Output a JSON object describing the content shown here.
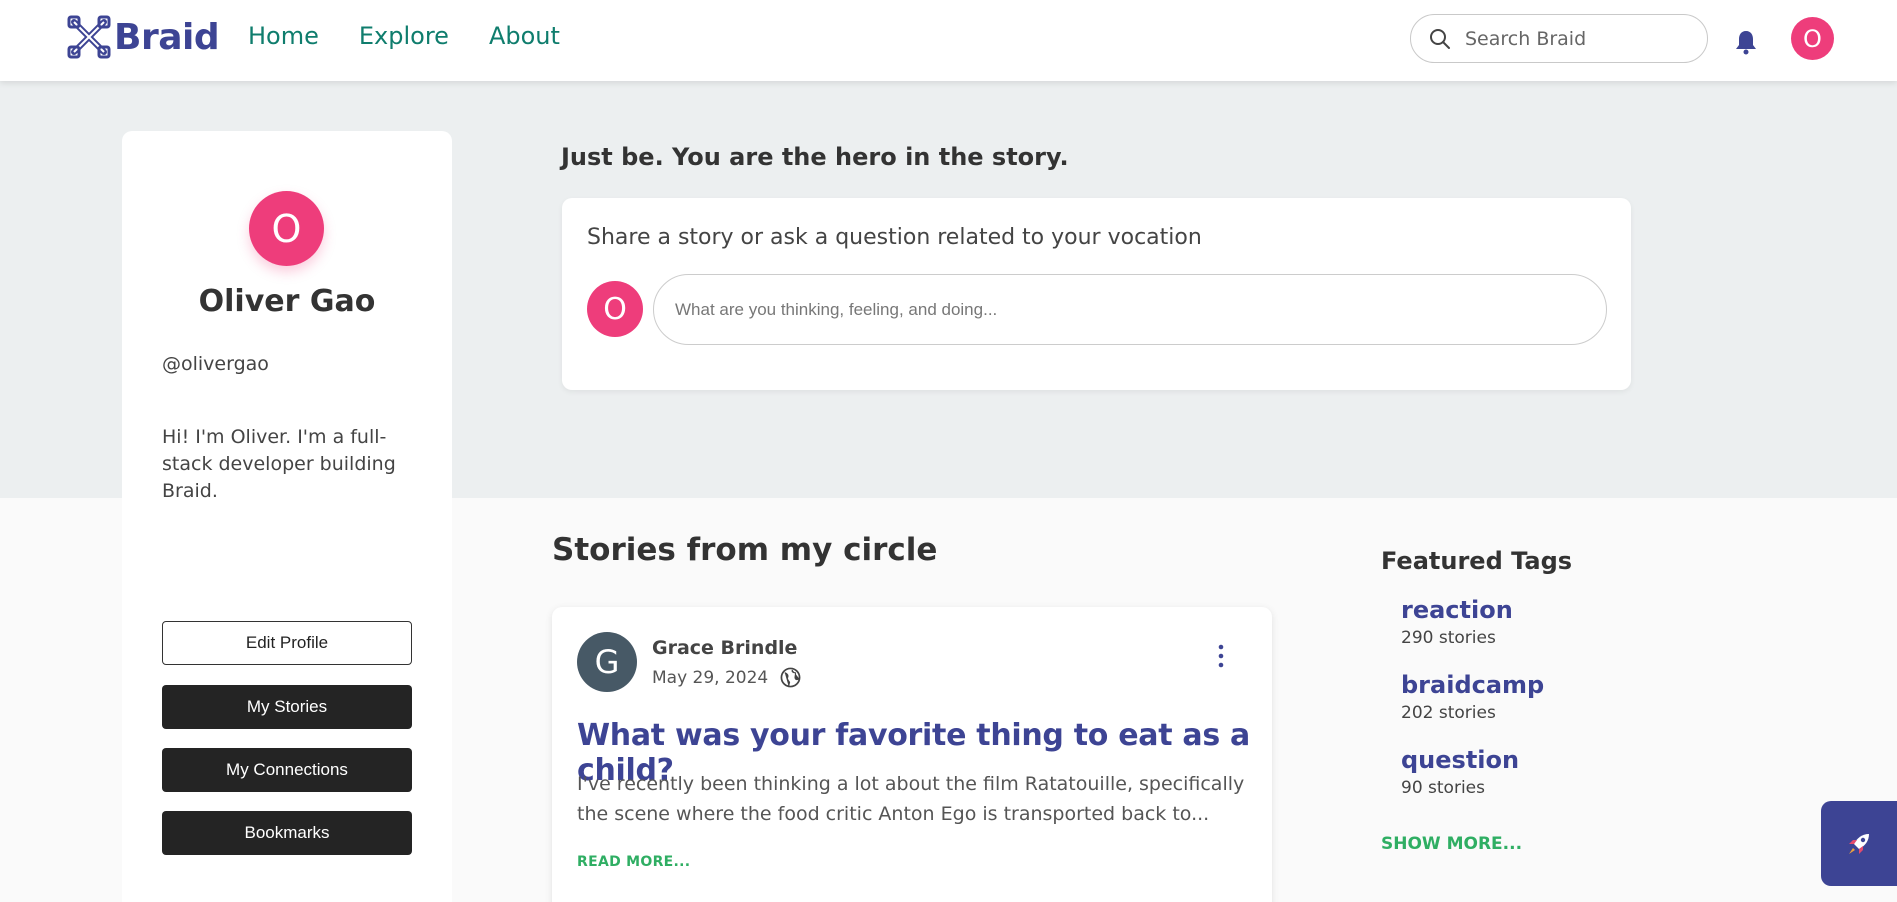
{
  "header": {
    "logo_text": "Braid",
    "nav": [
      {
        "label": "Home"
      },
      {
        "label": "Explore"
      },
      {
        "label": "About"
      }
    ],
    "search_placeholder": "Search Braid",
    "avatar_initial": "O"
  },
  "profile": {
    "initial": "O",
    "name": "Oliver Gao",
    "handle": "@olivergao",
    "bio": "Hi! I'm Oliver. I'm a full-stack developer building Braid.",
    "buttons": {
      "edit": "Edit Profile",
      "stories": "My Stories",
      "connections": "My Connections",
      "bookmarks": "Bookmarks"
    }
  },
  "hero": {
    "tagline": "Just be. You are the hero in the story.",
    "composer_label": "Share a story or ask a question related to your vocation",
    "composer_placeholder": "What are you thinking, feeling, and doing...",
    "avatar_initial": "O"
  },
  "stories": {
    "title": "Stories from my circle",
    "items": [
      {
        "author_initial": "G",
        "author": "Grace Brindle",
        "date": "May 29, 2024",
        "title": "What was your favorite thing to eat as a child?",
        "excerpt": "I've recently been thinking a lot about the film Ratatouille, specifically the scene where the food critic Anton Ego is transported back to...",
        "read_more": "READ MORE..."
      }
    ]
  },
  "featured_tags": {
    "title": "Featured Tags",
    "tags": [
      {
        "name": "reaction",
        "count": "290 stories"
      },
      {
        "name": "braidcamp",
        "count": "202 stories"
      },
      {
        "name": "question",
        "count": "90 stories"
      }
    ],
    "show_more": "SHOW MORE..."
  },
  "colors": {
    "brand": "#3d4494",
    "nav": "#0f7d6d",
    "avatar": "#ee3d7b",
    "accent_green": "#2fae63"
  }
}
